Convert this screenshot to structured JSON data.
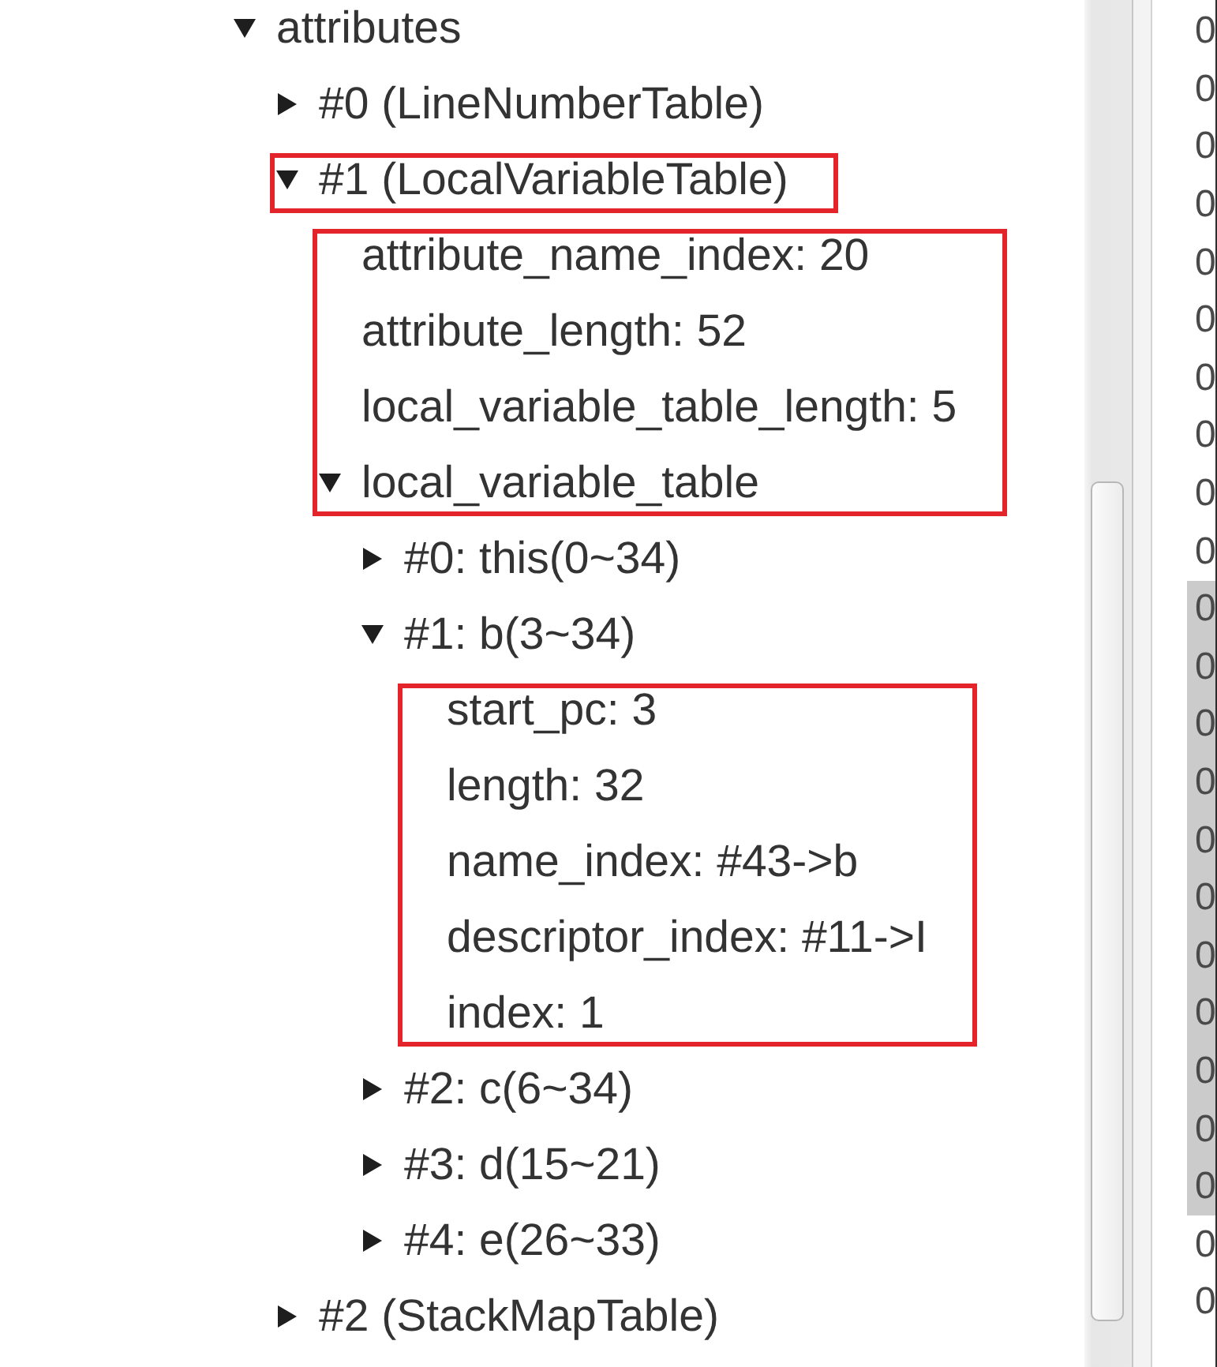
{
  "tree": {
    "nodes": [
      {
        "label": "attributes",
        "kind": "branch",
        "expanded": true,
        "boxed": false,
        "children": [
          {
            "label": "#0 (LineNumberTable)",
            "kind": "branch",
            "expanded": false,
            "boxed": false
          },
          {
            "label": "#1 (LocalVariableTable)",
            "kind": "branch",
            "expanded": true,
            "boxed": true,
            "children": [
              {
                "label": "attribute_name_index: 20",
                "kind": "leaf",
                "boxed": true
              },
              {
                "label": "attribute_length: 52",
                "kind": "leaf",
                "boxed": true
              },
              {
                "label": "local_variable_table_length: 5",
                "kind": "leaf",
                "boxed": true
              },
              {
                "label": "local_variable_table",
                "kind": "branch",
                "expanded": true,
                "boxed": true,
                "children": [
                  {
                    "label": "#0: this(0~34)",
                    "kind": "branch",
                    "expanded": false,
                    "boxed": false
                  },
                  {
                    "label": "#1: b(3~34)",
                    "kind": "branch",
                    "expanded": true,
                    "boxed": false,
                    "children": [
                      {
                        "label": "start_pc: 3",
                        "kind": "leaf",
                        "boxed": true
                      },
                      {
                        "label": "length: 32",
                        "kind": "leaf",
                        "boxed": true
                      },
                      {
                        "label": "name_index: #43->b",
                        "kind": "leaf",
                        "boxed": true
                      },
                      {
                        "label": "descriptor_index: #11->I",
                        "kind": "leaf",
                        "boxed": true
                      },
                      {
                        "label": "index: 1",
                        "kind": "leaf",
                        "boxed": true
                      }
                    ]
                  },
                  {
                    "label": "#2: c(6~34)",
                    "kind": "branch",
                    "expanded": false,
                    "boxed": false
                  },
                  {
                    "label": "#3: d(15~21)",
                    "kind": "branch",
                    "expanded": false,
                    "boxed": false
                  },
                  {
                    "label": "#4: e(26~33)",
                    "kind": "branch",
                    "expanded": false,
                    "boxed": false
                  }
                ]
              }
            ]
          },
          {
            "label": "#2 (StackMapTable)",
            "kind": "branch",
            "expanded": false,
            "boxed": false
          }
        ]
      }
    ]
  },
  "byte_column": [
    {
      "text": "0",
      "selected": false
    },
    {
      "text": "0",
      "selected": false
    },
    {
      "text": "0",
      "selected": false
    },
    {
      "text": "0",
      "selected": false
    },
    {
      "text": "0",
      "selected": false
    },
    {
      "text": "0",
      "selected": false
    },
    {
      "text": "0",
      "selected": false
    },
    {
      "text": "0",
      "selected": false
    },
    {
      "text": "0",
      "selected": false
    },
    {
      "text": "0",
      "selected": false
    },
    {
      "text": "0",
      "selected": true
    },
    {
      "text": "0",
      "selected": true
    },
    {
      "text": "0",
      "selected": true
    },
    {
      "text": "0",
      "selected": true
    },
    {
      "text": "0",
      "selected": true
    },
    {
      "text": "0",
      "selected": true
    },
    {
      "text": "0",
      "selected": true
    },
    {
      "text": "0",
      "selected": true
    },
    {
      "text": "0",
      "selected": true
    },
    {
      "text": "0",
      "selected": true
    },
    {
      "text": "0",
      "selected": true
    },
    {
      "text": "0",
      "selected": false
    },
    {
      "text": "0",
      "selected": false
    }
  ]
}
